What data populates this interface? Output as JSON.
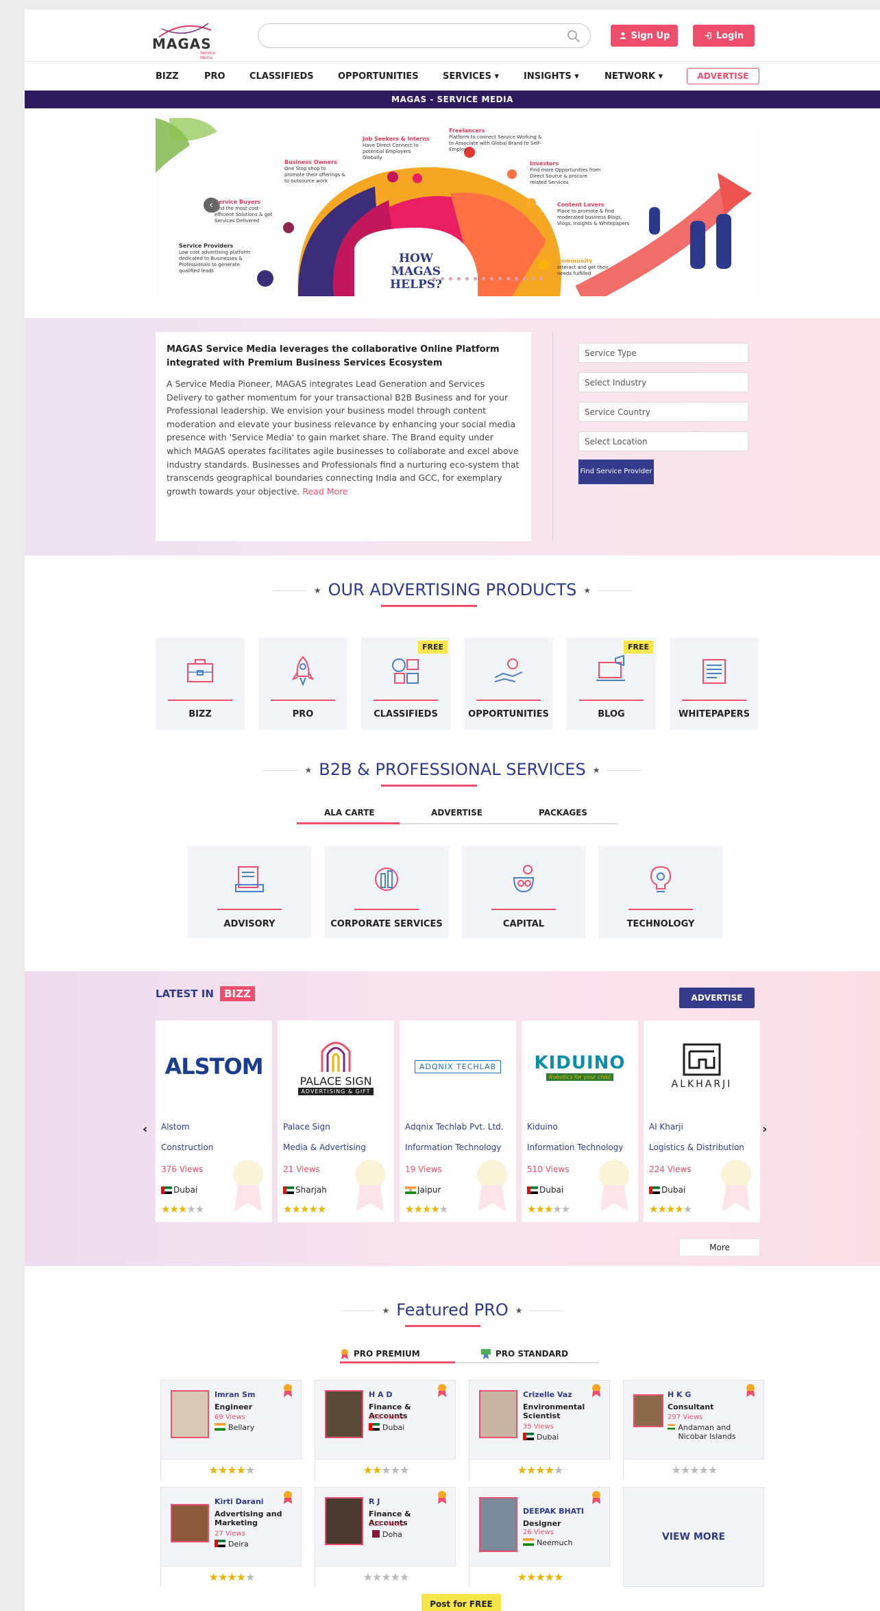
{
  "header": {
    "logo_text": "MAGAS",
    "logo_sub": "Service Media",
    "signup_label": "Sign Up",
    "login_label": "Login"
  },
  "nav": {
    "items": [
      "BIZZ",
      "PRO",
      "CLASSIFIEDS",
      "OPPORTUNITIES",
      "SERVICES ▾",
      "INSIGHTS ▾",
      "NETWORK ▾"
    ],
    "advertise_label": "ADVERTISE"
  },
  "band_title": "MAGAS - SERVICE MEDIA",
  "hero": {
    "center_title": "HOW\nMAGAS HELPS?",
    "labels": [
      {
        "head": "Job Seekers & Interns",
        "text": "Have Direct Connect to potential Employers Globally"
      },
      {
        "head": "Freelancers",
        "text": "Platform to connect Service Working & to Associate with Global Brand to Self-Employ"
      },
      {
        "head": "Business Owners",
        "text": "One Stop shop to promote their offerings & to outsource work"
      },
      {
        "head": "Investors",
        "text": "Find more Opportunities from Direct Source & procure related Services"
      },
      {
        "head": "Service Buyers",
        "text": "Find the most cost-efficient Solutions & get Services Delivered"
      },
      {
        "head": "Content Lovers",
        "text": "Place to promote & find moderated business Blogs, Vlogs, Insights & Whitepapers"
      },
      {
        "head": "Service Providers",
        "text": "Low cost advertising platform dedicated to Businesses & Professionals to generate qualified leads"
      },
      {
        "head": "Community",
        "text": "Interact and get their needs fulfilled"
      }
    ]
  },
  "intro": {
    "heading": "MAGAS Service Media leverages the collaborative Online Platform integrated with Premium Business Services Ecosystem",
    "body": "A Service Media Pioneer, MAGAS integrates Lead Generation and Services Delivery to gather momentum for your transactional B2B Business and for your Professional leadership. We envision your business model through content moderation and elevate your business relevance by enhancing your social media presence with 'Service Media' to gain market share. The Brand equity under which MAGAS operates facilitates agile businesses to collaborate and excel above industry standards. Businesses and Professionals find a nurturing eco-system that transcends geographical boundaries connecting India and GCC, for exemplary growth towards your objective.",
    "read_more": "Read More",
    "fields": [
      "Service Type",
      "Select Industry",
      "Service Country",
      "Select Location"
    ],
    "find_label": "Find Service Provider"
  },
  "advertising": {
    "title": "OUR ADVERTISING PRODUCTS",
    "free_label": "FREE",
    "products": [
      {
        "label": "BIZZ",
        "icon": "briefcase-icon",
        "free": false
      },
      {
        "label": "PRO",
        "icon": "rocket-icon",
        "free": false
      },
      {
        "label": "CLASSIFIEDS",
        "icon": "classifieds-icon",
        "free": true
      },
      {
        "label": "OPPORTUNITIES",
        "icon": "handshake-idea-icon",
        "free": false
      },
      {
        "label": "BLOG",
        "icon": "megaphone-laptop-icon",
        "free": true
      },
      {
        "label": "WHITEPAPERS",
        "icon": "document-stack-icon",
        "free": false
      }
    ]
  },
  "b2b": {
    "title": "B2B & PROFESSIONAL SERVICES",
    "tabs": [
      "ALA CARTE",
      "ADVERTISE",
      "PACKAGES"
    ],
    "services": [
      {
        "label": "ADVISORY",
        "icon": "advisory-icon"
      },
      {
        "label": "CORPORATE SERVICES",
        "icon": "corporate-globe-icon"
      },
      {
        "label": "CAPITAL",
        "icon": "money-bag-icon"
      },
      {
        "label": "TECHNOLOGY",
        "icon": "tech-bulb-icon"
      }
    ]
  },
  "bizz": {
    "title_prefix": "LATEST IN",
    "title_badge": "BIZZ",
    "advertise_label": "ADVERTISE",
    "more_label": "More",
    "prev": "‹",
    "next": "›",
    "cards": [
      {
        "logo": "ALSTOM",
        "name": "Alstom",
        "category": "Construction",
        "views": "376 Views",
        "city": "Dubai",
        "flag": "uae",
        "rating": 3
      },
      {
        "logo": "PALACE SIGN",
        "logo_sub": "ADVERTISING & GIFT",
        "name": "Palace Sign",
        "category": "Media & Advertising",
        "views": "21 Views",
        "city": "Sharjah",
        "flag": "uae",
        "rating": 5
      },
      {
        "logo": "ADQNIX TECHLAB",
        "name": "Adqnix Techlab Pvt. Ltd.",
        "category": "Information Technology",
        "views": "19 Views",
        "city": "Jaipur",
        "flag": "india",
        "rating": 4
      },
      {
        "logo": "KIDUINO",
        "logo_sub": "Robotics for your child",
        "name": "Kiduino",
        "category": "Information Technology",
        "views": "510 Views",
        "city": "Dubai",
        "flag": "uae",
        "rating": 3
      },
      {
        "logo": "ALKHARJI",
        "name": "Al Kharji",
        "category": "Logistics & Distribution",
        "views": "224 Views",
        "city": "Dubai",
        "flag": "uae",
        "rating": 4
      }
    ]
  },
  "pro": {
    "title": "Featured PRO",
    "tabs": [
      "PRO PREMIUM",
      "PRO STANDARD"
    ],
    "view_more": "VIEW MORE",
    "post_free": "Post for FREE",
    "cards": [
      {
        "name": "Imran Sm",
        "role": "Engineer",
        "views": "69 Views",
        "city": "Bellary",
        "flag": "india",
        "rating": 4
      },
      {
        "name": "H A D",
        "role": "Finance & Accounts",
        "views": "398 Views",
        "city": "Dubai",
        "flag": "uae",
        "rating": 2
      },
      {
        "name": "Crizelle Vaz",
        "role": "Environmental Scientist",
        "views": "35 Views",
        "city": "Dubai",
        "flag": "uae",
        "rating": 4
      },
      {
        "name": "H K G",
        "role": "Consultant",
        "views": "297 Views",
        "city": "Andaman and Nicobar Islands",
        "flag": "india",
        "rating": 0
      },
      {
        "name": "Kirti Darani",
        "role": "Advertising and Marketing",
        "views": "27 Views",
        "city": "Deira",
        "flag": "uae",
        "rating": 4
      },
      {
        "name": "R J",
        "role": "Finance & Accounts",
        "views": "218 Views",
        "city": "Doha",
        "flag": "qatar",
        "rating": 0
      },
      {
        "name": "DEEPAK BHATI",
        "role": "Designer",
        "views": "26 Views",
        "city": "Neemuch",
        "flag": "india",
        "rating": 5
      }
    ]
  },
  "colors": {
    "accent": "#ee4e6b",
    "navy": "#2d3a8c",
    "band": "#2d1b5e",
    "star": "#e8b500"
  }
}
